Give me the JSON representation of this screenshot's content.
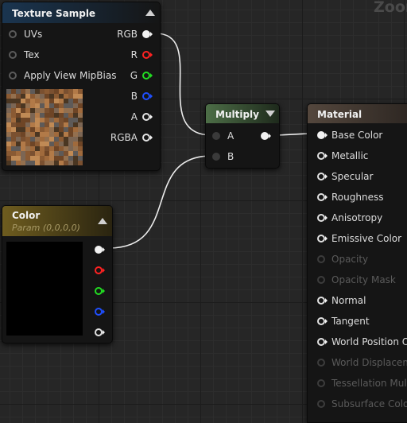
{
  "canvas": {
    "zoom_label": "Zoom"
  },
  "colors": {
    "texture_header": "#1a3550",
    "multiply_header": "#4d6e47",
    "color_header": "#6e5c1f",
    "material_header": "#54473d",
    "wire": "#ececec",
    "pin_red": "#ff2222",
    "pin_green": "#22dd22",
    "pin_blue": "#1f4fff",
    "pin_white": "#f2f2f2"
  },
  "texture_sample": {
    "title": "Texture Sample",
    "inputs": [
      {
        "label": "UVs"
      },
      {
        "label": "Tex"
      },
      {
        "label": "Apply View MipBias"
      }
    ],
    "outputs": [
      {
        "label": "RGB",
        "color": "white",
        "connected": true
      },
      {
        "label": "R",
        "color": "red"
      },
      {
        "label": "G",
        "color": "green"
      },
      {
        "label": "B",
        "color": "blue"
      },
      {
        "label": "A",
        "color": "white"
      },
      {
        "label": "RGBA",
        "color": "white"
      }
    ],
    "preview": "dirt-texture-preview"
  },
  "multiply": {
    "title": "Multiply",
    "inputs": [
      {
        "label": "A"
      },
      {
        "label": "B"
      }
    ]
  },
  "color_param": {
    "title": "Color",
    "subtitle": "Param (0,0,0,0)",
    "preview_color": "#000000",
    "outputs": [
      "white",
      "red",
      "green",
      "blue",
      "white"
    ]
  },
  "material": {
    "title": "Material",
    "inputs": [
      {
        "label": "Base Color",
        "enabled": true,
        "connected": true
      },
      {
        "label": "Metallic",
        "enabled": true
      },
      {
        "label": "Specular",
        "enabled": true
      },
      {
        "label": "Roughness",
        "enabled": true
      },
      {
        "label": "Anisotropy",
        "enabled": true
      },
      {
        "label": "Emissive Color",
        "enabled": true
      },
      {
        "label": "Opacity",
        "enabled": false
      },
      {
        "label": "Opacity Mask",
        "enabled": false
      },
      {
        "label": "Normal",
        "enabled": true
      },
      {
        "label": "Tangent",
        "enabled": true
      },
      {
        "label": "World Position Of",
        "enabled": true
      },
      {
        "label": "World Displaceme",
        "enabled": false
      },
      {
        "label": "Tessellation Mult",
        "enabled": false
      },
      {
        "label": "Subsurface Color",
        "enabled": false
      }
    ]
  }
}
